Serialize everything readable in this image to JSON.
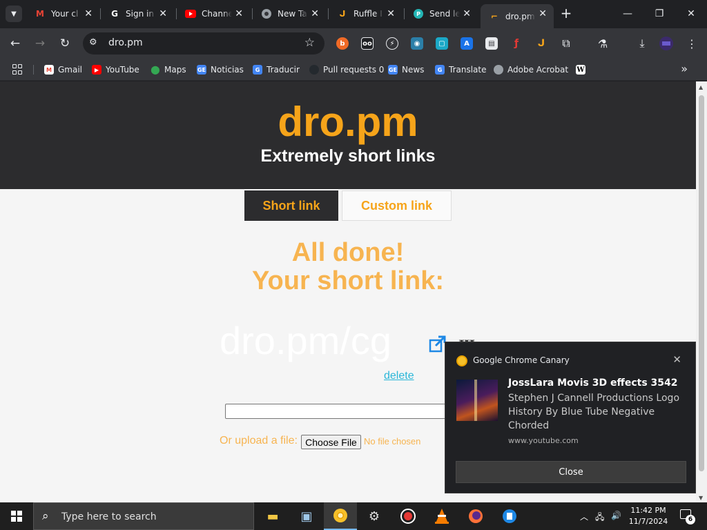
{
  "browser": {
    "tabs": [
      {
        "title": "Your cl",
        "favicon": "gmail-icon",
        "active": false
      },
      {
        "title": "Sign in",
        "favicon": "google-icon",
        "active": false
      },
      {
        "title": "Channe",
        "favicon": "youtube-icon",
        "active": false
      },
      {
        "title": "New Ta",
        "favicon": "chrome-icon",
        "active": false
      },
      {
        "title": "Ruffle I",
        "favicon": "ruffle-icon",
        "active": false
      },
      {
        "title": "Send le",
        "favicon": "send-icon",
        "active": false
      },
      {
        "title": "dro.pm",
        "favicon": "dropm-icon",
        "active": true
      }
    ],
    "address": "dro.pm",
    "bookmarks": [
      {
        "label": "Gmail",
        "icon": "gmail-icon",
        "color": "#ea4335"
      },
      {
        "label": "YouTube",
        "icon": "youtube-icon",
        "color": "#ff0000"
      },
      {
        "label": "Maps",
        "icon": "maps-icon",
        "color": "#34a853"
      },
      {
        "label": "Noticias",
        "icon": "news-icon",
        "color": "#4285f4"
      },
      {
        "label": "Traducir",
        "icon": "translate-icon",
        "color": "#4285f4"
      },
      {
        "label": "Pull requests 0",
        "icon": "github-icon",
        "color": "#24292e"
      },
      {
        "label": "News",
        "icon": "news-icon",
        "color": "#4285f4"
      },
      {
        "label": "Translate",
        "icon": "translate-icon",
        "color": "#4285f4"
      },
      {
        "label": "Adobe Acrobat",
        "icon": "globe-icon",
        "color": "#9aa0a6"
      },
      {
        "label": "",
        "icon": "wikipedia-icon",
        "color": "#ffffff"
      }
    ]
  },
  "page": {
    "logo": "dro.pm",
    "tagline": "Extremely short links",
    "tab_short": "Short link",
    "tab_custom": "Custom link",
    "done_line1": "All done!",
    "done_line2": "Your short link:",
    "short_link": "dro.pm/cg",
    "delete_label": "delete",
    "upload_label": "Or upload a file:",
    "choose_file": "Choose File",
    "no_file": "No file chosen",
    "colors": {
      "accent": "#f6a41a",
      "header_bg": "#2c2c2e",
      "link": "#29b6d8"
    }
  },
  "notification": {
    "app": "Google Chrome Canary",
    "title": "JossLara Movis 3D effects 3542",
    "body": "Stephen J Cannell Productions Logo History By Blue Tube Negative Chorded",
    "site": "www.youtube.com",
    "button": "Close"
  },
  "taskbar": {
    "search_placeholder": "Type here to search",
    "time": "11:42 PM",
    "date": "11/7/2024",
    "notification_count": "6"
  }
}
